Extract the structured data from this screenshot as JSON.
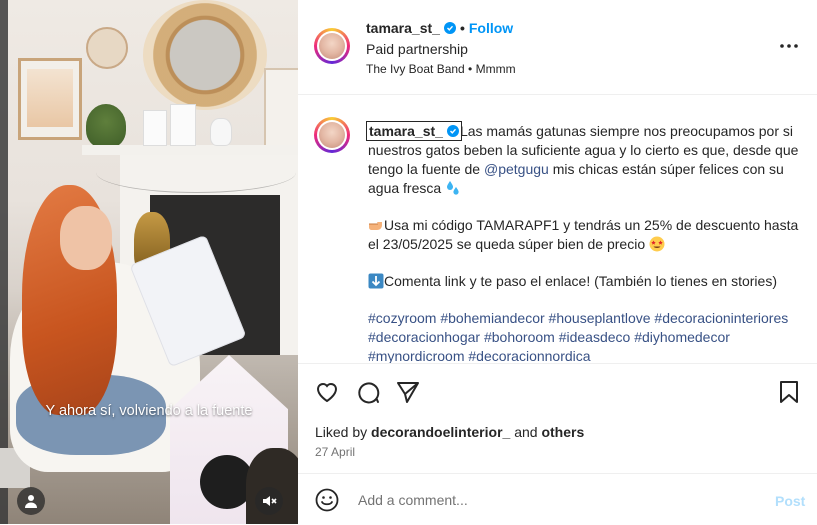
{
  "media": {
    "caption": "Y ahora sí, volviendo a la fuente",
    "user_icon": "person-icon",
    "mute_icon": "speaker-muted-icon"
  },
  "header": {
    "username": "tamara_st_",
    "separator": "•",
    "follow_label": "Follow",
    "paid_partnership": "Paid partnership",
    "audio": "The Ivy Boat Band • Mmmm",
    "more_icon": "more-horizontal-icon"
  },
  "post": {
    "username": "tamara_st_",
    "text_part1": "Las mamás gatunas siempre nos preocupamos por si nuestros gatos beben la suficiente agua y lo cierto es que, desde que tengo la fuente de ",
    "mention": "@petgugu",
    "text_part2": " mis chicas están súper felices con su agua fresca ",
    "promo_text": "Usa mi código TAMARAPF1 y tendrás un 25% de descuento hasta el 23/05/2025 se queda súper bien de precio ",
    "link_text": "Comenta link y te paso el enlace! (También lo tienes en stories)",
    "hashtags": "#cozyroom #bohemiandecor #houseplantlove #decoracioninteriores #decoracionhogar #bohoroom #ideasdeco #diyhomedecor #mynordicroom #decoracionnordica"
  },
  "actions": {
    "liked_prefix": "Liked by ",
    "liked_user": "decorandoelinterior_",
    "liked_and": " and ",
    "liked_others": "others",
    "date": "27 April"
  },
  "comment_box": {
    "placeholder": "Add a comment...",
    "post_label": "Post"
  },
  "colors": {
    "accent": "#0095f6",
    "hashtag": "#385185",
    "post_disabled": "#b2dffc"
  }
}
